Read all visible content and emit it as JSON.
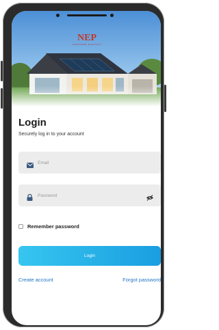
{
  "brand": {
    "logo_text": "NEP",
    "logo_subtext": "NORTHERN ELECTRIC"
  },
  "login": {
    "title": "Login",
    "subtitle": "Securely log in to your account",
    "email_placeholder": "Email",
    "password_placeholder": "Password",
    "remember_label": "Remember password",
    "login_button": "Login",
    "create_account": "Create account",
    "forgot_password": "Forgot password"
  },
  "colors": {
    "accent": "#1a9ee0",
    "link": "#1f74c4",
    "logo": "#c0392b"
  }
}
